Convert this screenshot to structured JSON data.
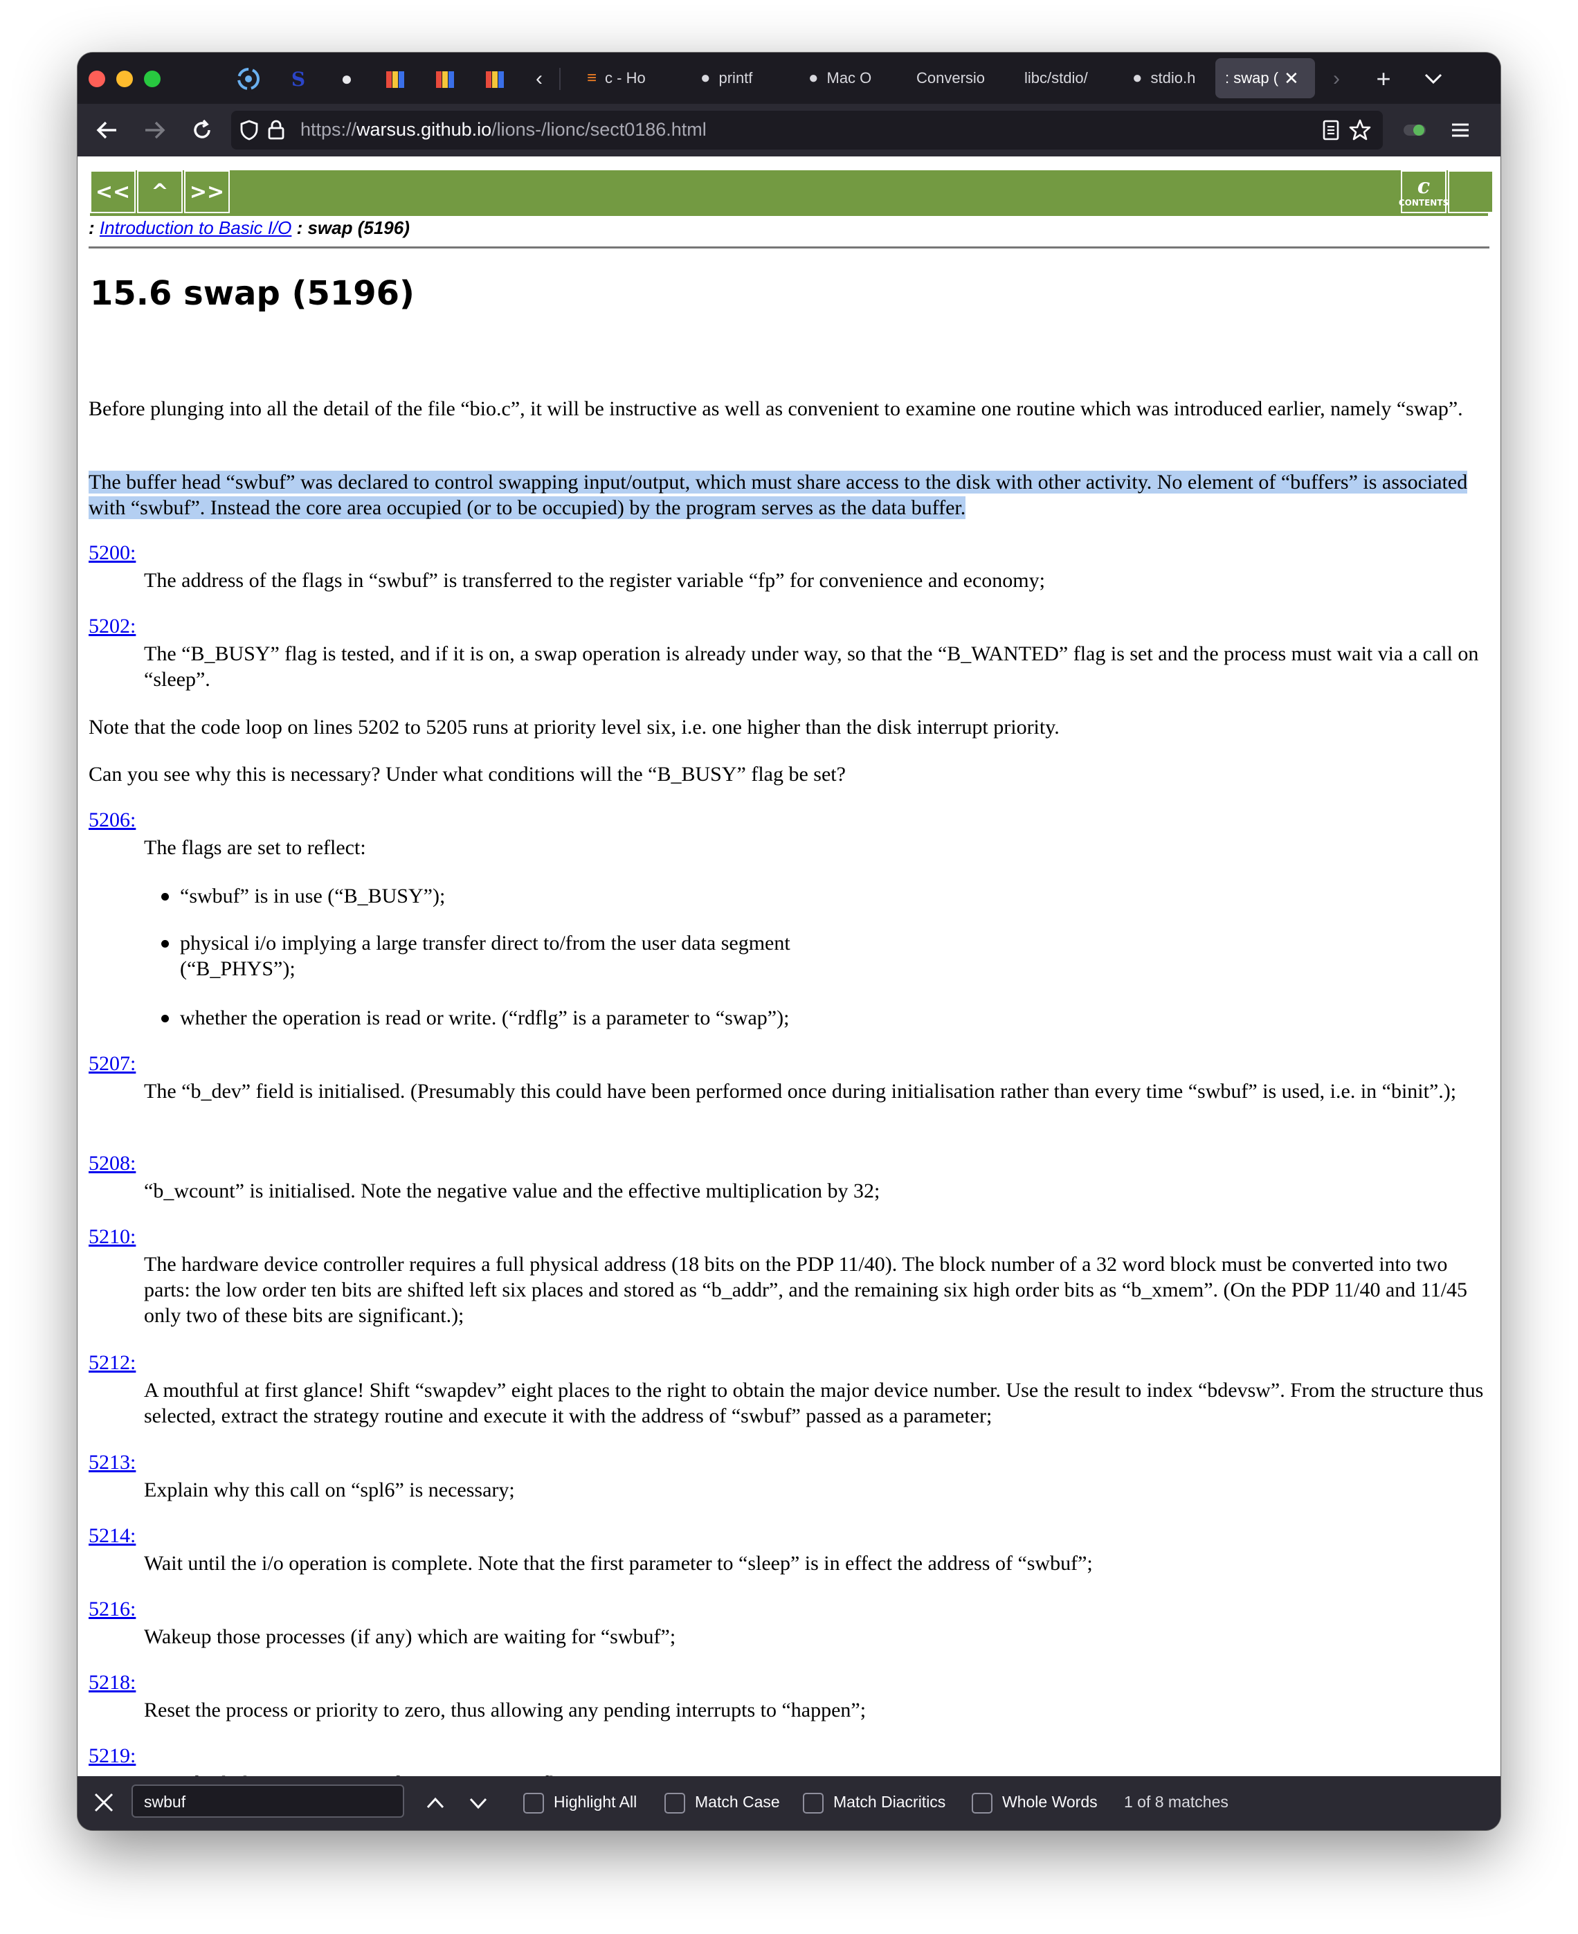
{
  "browser": {
    "tabs": [
      {
        "label": "c - Ho",
        "icon": "stackoverflow-icon"
      },
      {
        "label": "printf",
        "icon": "apple-icon"
      },
      {
        "label": "Mac O",
        "icon": "apple-icon"
      },
      {
        "label": "Conversio",
        "icon": ""
      },
      {
        "label": "libc/stdio/",
        "icon": ""
      },
      {
        "label": "stdio.h",
        "icon": "apple-icon"
      },
      {
        "label": ": swap (",
        "icon": ""
      }
    ],
    "url_scheme": "https://",
    "url_host": "warsus.github.io",
    "url_path": "/lions-/lionc/sect0186.html"
  },
  "nav": {
    "prev": "<<",
    "up": "^",
    "next": ">>",
    "contents_symbol": "c",
    "contents_label": "CONTENTS"
  },
  "breadcrumb": {
    "prefix": ": ",
    "parent": "Introduction to Basic I/O",
    "current": " : swap (5196)"
  },
  "heading": "15.6 swap (5196)",
  "intro": [
    "Before plunging into all the detail of the file “bio.c”, it will be instructive as well as convenient to examine one routine which was introduced earlier, namely “swap”.",
    "The buffer head “swbuf” was declared to control swapping input/output, which must share access to the disk with other activity. No element of “buffers” is associated with “swbuf”. Instead the core area occupied (or to be occupied) by the program serves as the data buffer."
  ],
  "entries": [
    {
      "line": "5200:",
      "text": "The address of the flags in “swbuf” is transferred to the register variable “fp” for convenience and economy;"
    },
    {
      "line": "5202:",
      "text": "The “B_BUSY” flag is tested, and if it is on, a swap operation is already under way, so that the “B_WANTED” flag is set and the process must wait via a call on “sleep”."
    },
    {
      "line": "5206:",
      "text": "The flags are set to reflect:"
    },
    {
      "line": "5207:",
      "text": "The “b_dev” field is initialised. (Presumably this could have been performed once during initialisation rather than every time “swbuf” is used, i.e. in “binit”.);"
    },
    {
      "line": "5208:",
      "text": "“b_wcount” is initialised. Note the negative value and the effective multiplication by 32;"
    },
    {
      "line": "5210:",
      "text": "The hardware device controller requires a full physical address (18 bits on the PDP 11/40). The block number of a 32 word block must be converted into two parts: the low order ten bits are shifted left six places and stored as “b_addr”, and the remaining six high order bits as “b_xmem”. (On the PDP 11/40 and 11/45 only two of these bits are significant.);"
    },
    {
      "line": "5212:",
      "text": "A mouthful at first glance! Shift “swapdev” eight places to the right to obtain the major device number. Use the result to index “bdevsw”. From the structure thus selected, extract the strategy routine and execute it with the address of “swbuf” passed as a parameter;"
    },
    {
      "line": "5213:",
      "text": "Explain why this call on “spl6” is necessary;"
    },
    {
      "line": "5214:",
      "text": "Wait until the i/o operation is complete. Note that the first parameter to “sleep” is in effect the address of “swbuf”;"
    },
    {
      "line": "5216:",
      "text": "Wakeup those processes (if any) which are waiting for “swbuf”;"
    },
    {
      "line": "5218:",
      "text": "Reset the process or priority to zero, thus allowing any pending interrupts to “happen”;"
    },
    {
      "line": "5219:",
      "text": "Reset both the “B_BUSY” and “B_WANTED” flags."
    }
  ],
  "notes": [
    "Note that the code loop on lines 5202 to 5205 runs at priority level six, i.e. one higher than the disk interrupt priority.",
    "Can you see why this is necessary? Under what conditions will the “B_BUSY” flag be set?"
  ],
  "bullets": [
    "“swbuf” is in use (“B_BUSY”);",
    "physical i/o implying a large transfer direct to/from the user data segment (“B_PHYS”);",
    "whether the operation is read or write. (“rdflg” is a parameter to “swap”);"
  ],
  "findbar": {
    "query": "swbuf",
    "options": [
      "Highlight All",
      "Match Case",
      "Match Diacritics",
      "Whole Words"
    ],
    "status": "1 of 8 matches"
  },
  "colors": {
    "nav_green": "#739a42",
    "link": "#0000ee",
    "highlight": "#b4cff2",
    "chrome_dark": "#1c1b22",
    "toolbar": "#2b2a33"
  }
}
